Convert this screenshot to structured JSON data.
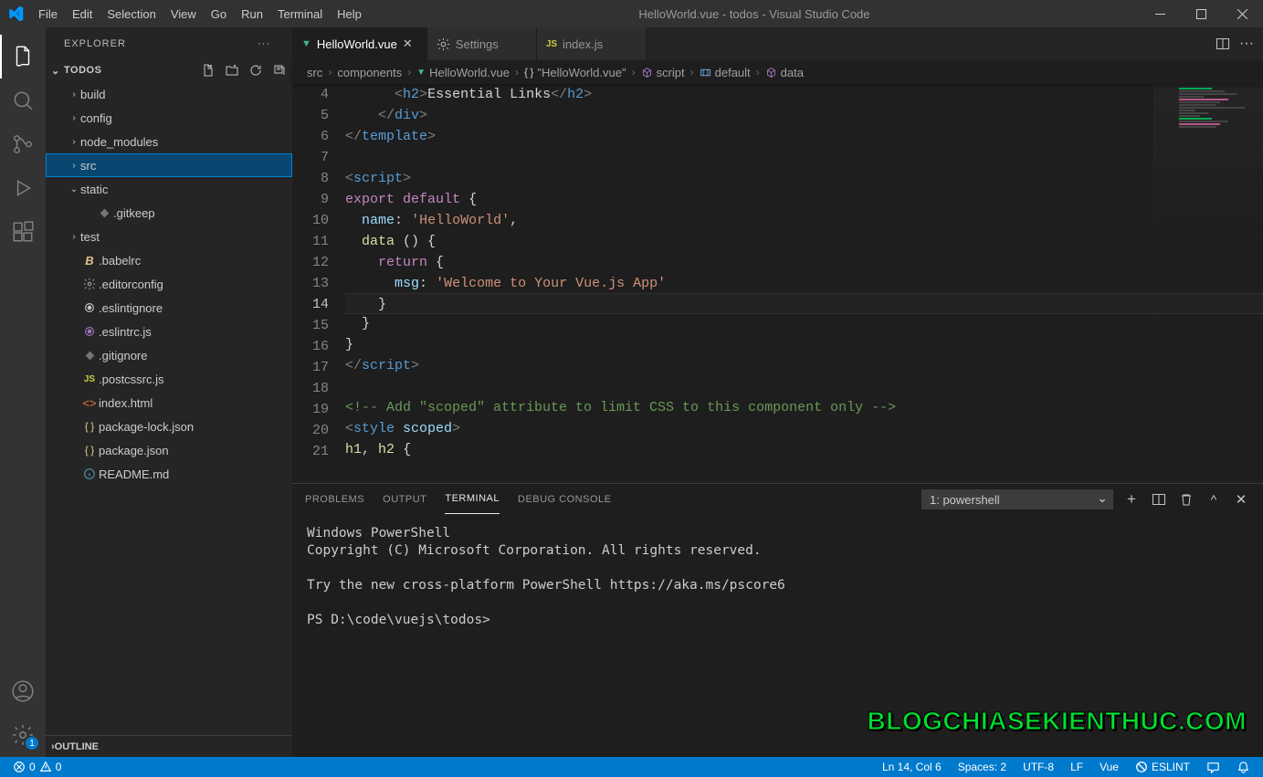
{
  "titlebar": {
    "menus": [
      "File",
      "Edit",
      "Selection",
      "View",
      "Go",
      "Run",
      "Terminal",
      "Help"
    ],
    "title": "HelloWorld.vue - todos - Visual Studio Code"
  },
  "activitybar": {
    "settings_badge": "1"
  },
  "sidebar": {
    "title": "EXPLORER",
    "folder": "TODOS",
    "tree": [
      {
        "type": "fold",
        "label": "build",
        "indent": 1
      },
      {
        "type": "fold",
        "label": "config",
        "indent": 1
      },
      {
        "type": "fold",
        "label": "node_modules",
        "indent": 1
      },
      {
        "type": "fold",
        "label": "src",
        "indent": 1,
        "selected": true
      },
      {
        "type": "fold",
        "label": "static",
        "indent": 1,
        "open": true
      },
      {
        "type": "file",
        "label": ".gitkeep",
        "indent": 2,
        "icon": "diamond",
        "color": "ic-gear"
      },
      {
        "type": "fold",
        "label": "test",
        "indent": 1
      },
      {
        "type": "file",
        "label": ".babelrc",
        "indent": 1,
        "icon": "B",
        "color": "ic-yellow",
        "italic": true
      },
      {
        "type": "file",
        "label": ".editorconfig",
        "indent": 1,
        "icon": "gear",
        "color": "ic-gear"
      },
      {
        "type": "file",
        "label": ".eslintignore",
        "indent": 1,
        "icon": "circle",
        "color": "ic-gear"
      },
      {
        "type": "file",
        "label": ".eslintrc.js",
        "indent": 1,
        "icon": "circle",
        "color": "ic-purple"
      },
      {
        "type": "file",
        "label": ".gitignore",
        "indent": 1,
        "icon": "diamond",
        "color": "ic-gear"
      },
      {
        "type": "file",
        "label": ".postcssrc.js",
        "indent": 1,
        "icon": "JS",
        "color": "ic-js"
      },
      {
        "type": "file",
        "label": "index.html",
        "indent": 1,
        "icon": "<>",
        "color": "ic-orange"
      },
      {
        "type": "file",
        "label": "package-lock.json",
        "indent": 1,
        "icon": "{}",
        "color": "ic-yellow"
      },
      {
        "type": "file",
        "label": "package.json",
        "indent": 1,
        "icon": "{}",
        "color": "ic-yellow"
      },
      {
        "type": "file",
        "label": "README.md",
        "indent": 1,
        "icon": "ⓘ",
        "color": "ic-info"
      }
    ],
    "outline": "OUTLINE"
  },
  "tabs": [
    {
      "label": "HelloWorld.vue",
      "icon": "vue",
      "active": true
    },
    {
      "label": "Settings",
      "icon": "gear"
    },
    {
      "label": "index.js",
      "icon": "js"
    }
  ],
  "breadcrumbs": [
    {
      "label": "src"
    },
    {
      "label": "components"
    },
    {
      "label": "HelloWorld.vue",
      "icon": "vue"
    },
    {
      "label": "\"HelloWorld.vue\"",
      "icon": "{}"
    },
    {
      "label": "script",
      "icon": "cube"
    },
    {
      "label": "default",
      "icon": "ns"
    },
    {
      "label": "data",
      "icon": "cube"
    }
  ],
  "code": {
    "start": 4,
    "current": 14,
    "lines": [
      {
        "html": "      <span class='tk-brack'>&lt;</span><span class='tk-tag'>h2</span><span class='tk-brack'>&gt;</span><span class='tk-text'>Essential Links</span><span class='tk-brack'>&lt;/</span><span class='tk-tag'>h2</span><span class='tk-brack'>&gt;</span>"
      },
      {
        "html": "    <span class='tk-brack'>&lt;/</span><span class='tk-tag'>div</span><span class='tk-brack'>&gt;</span>"
      },
      {
        "html": "<span class='tk-brack'>&lt;/</span><span class='tk-tag'>template</span><span class='tk-brack'>&gt;</span>"
      },
      {
        "html": ""
      },
      {
        "html": "<span class='tk-brack'>&lt;</span><span class='tk-tag'>script</span><span class='tk-brack'>&gt;</span>"
      },
      {
        "html": "<span class='tk-kw-red'>export</span> <span class='tk-kw-red'>default</span> <span class='tk-text'>{</span>"
      },
      {
        "html": "  <span class='tk-name'>name</span><span class='tk-text'>:</span> <span class='tk-str'>'HelloWorld'</span><span class='tk-text'>,</span>"
      },
      {
        "html": "  <span class='tk-fn'>data</span> <span class='tk-text'>() {</span>"
      },
      {
        "html": "    <span class='tk-kw-red'>return</span> <span class='tk-text'>{</span>"
      },
      {
        "html": "      <span class='tk-name'>msg</span><span class='tk-text'>:</span> <span class='tk-str'>'Welcome to Your Vue.js App'</span>"
      },
      {
        "html": "    <span class='tk-text'>}</span>"
      },
      {
        "html": "  <span class='tk-text'>}</span>"
      },
      {
        "html": "<span class='tk-text'>}</span>"
      },
      {
        "html": "<span class='tk-brack'>&lt;/</span><span class='tk-tag'>script</span><span class='tk-brack'>&gt;</span>"
      },
      {
        "html": ""
      },
      {
        "html": "<span class='tk-comment'>&lt;!-- Add \"scoped\" attribute to limit CSS to this component only --&gt;</span>"
      },
      {
        "html": "<span class='tk-brack'>&lt;</span><span class='tk-tag'>style</span> <span class='tk-attr'>scoped</span><span class='tk-brack'>&gt;</span>"
      },
      {
        "html": "<span class='tk-fn'>h1</span><span class='tk-text'>,</span> <span class='tk-fn'>h2</span> <span class='tk-text'>{</span>"
      }
    ]
  },
  "panel": {
    "tabs": [
      "PROBLEMS",
      "OUTPUT",
      "TERMINAL",
      "DEBUG CONSOLE"
    ],
    "active": "TERMINAL",
    "shell": "1: powershell",
    "content": [
      "Windows PowerShell",
      "Copyright (C) Microsoft Corporation. All rights reserved.",
      "",
      "Try the new cross-platform PowerShell https://aka.ms/pscore6",
      "",
      "PS D:\\code\\vuejs\\todos>"
    ]
  },
  "watermark": "BLOGCHIASEKIENTHUC.COM",
  "statusbar": {
    "errors": "0",
    "warnings": "0",
    "position": "Ln 14, Col 6",
    "spaces": "Spaces: 2",
    "encoding": "UTF-8",
    "eol": "LF",
    "lang": "Vue",
    "eslint": "ESLINT"
  }
}
